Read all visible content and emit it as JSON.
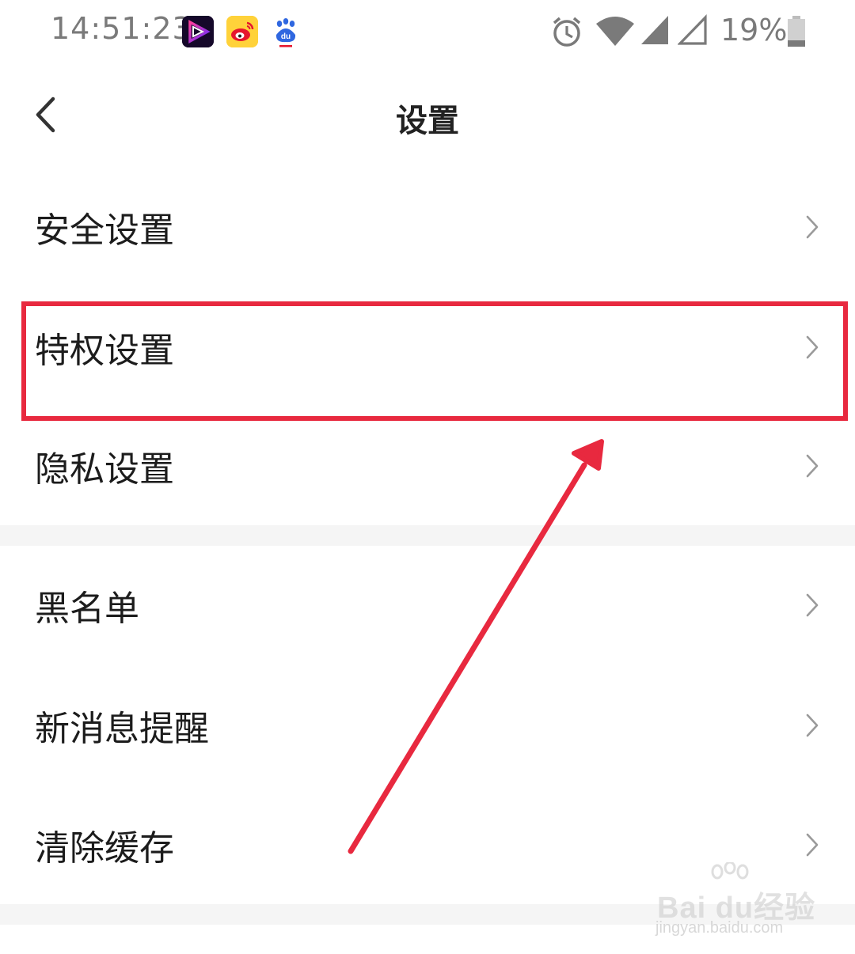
{
  "status_bar": {
    "time": "14:51:23",
    "battery_percent": "19%",
    "notification_icons": [
      "video-app-icon",
      "weibo-icon",
      "baidu-icon"
    ],
    "system_icons": [
      "alarm-icon",
      "wifi-icon",
      "cell-signal-icon",
      "cell-signal-empty-icon",
      "battery-icon"
    ]
  },
  "header": {
    "title": "设置",
    "back_icon": "chevron-left-icon"
  },
  "settings": {
    "items": [
      {
        "label": "安全设置",
        "icon": "chevron-right-icon"
      },
      {
        "label": "特权设置",
        "icon": "chevron-right-icon",
        "highlighted": true
      },
      {
        "label": "隐私设置",
        "icon": "chevron-right-icon"
      },
      {
        "label": "黑名单",
        "icon": "chevron-right-icon"
      },
      {
        "label": "新消息提醒",
        "icon": "chevron-right-icon"
      },
      {
        "label": "清除缓存",
        "icon": "chevron-right-icon"
      }
    ]
  },
  "annotation": {
    "highlight_color": "#e8293f",
    "arrow_color": "#e8293f"
  },
  "watermark": {
    "brand": "Bai du经验",
    "url": "jingyan.baidu.com"
  },
  "colors": {
    "text": "#1c1c1c",
    "chevron": "#9a9a9a",
    "section_gap": "#f5f5f5",
    "status_text": "#7a7a7a"
  }
}
